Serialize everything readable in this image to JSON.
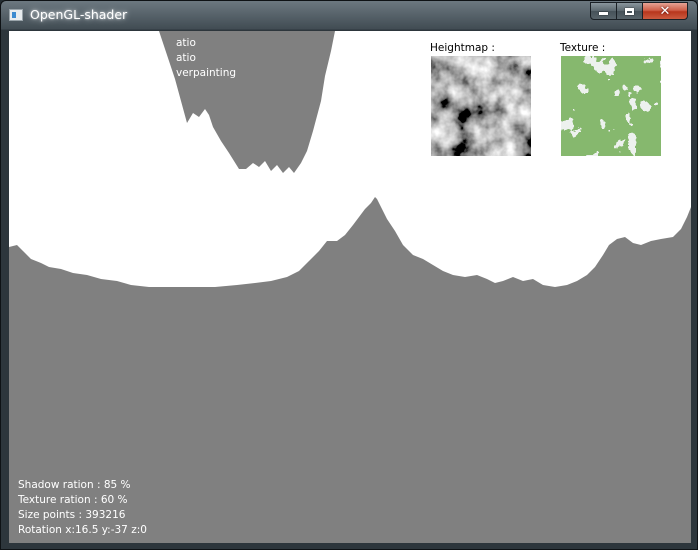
{
  "window": {
    "title": "OpenGL-shader",
    "controls": {
      "minimize": "minimize",
      "maximize": "maximize",
      "close": "close"
    }
  },
  "overlay_menu": [
    "atio",
    "atio",
    "verpainting"
  ],
  "panels": {
    "heightmap_label": "Heightmap :",
    "texture_label": "Texture :"
  },
  "stats": {
    "shadow": "Shadow ration : 85 %",
    "texture": "Texture ration : 60 %",
    "size_points": "Size points : 393216",
    "rotation": "Rotation x:16.5 y:-37 z:0"
  },
  "colors": {
    "terrain": "#808080",
    "sky": "#ffffff",
    "texture_green": "#3d7a2a",
    "texture_water": "#6a6fe0"
  }
}
